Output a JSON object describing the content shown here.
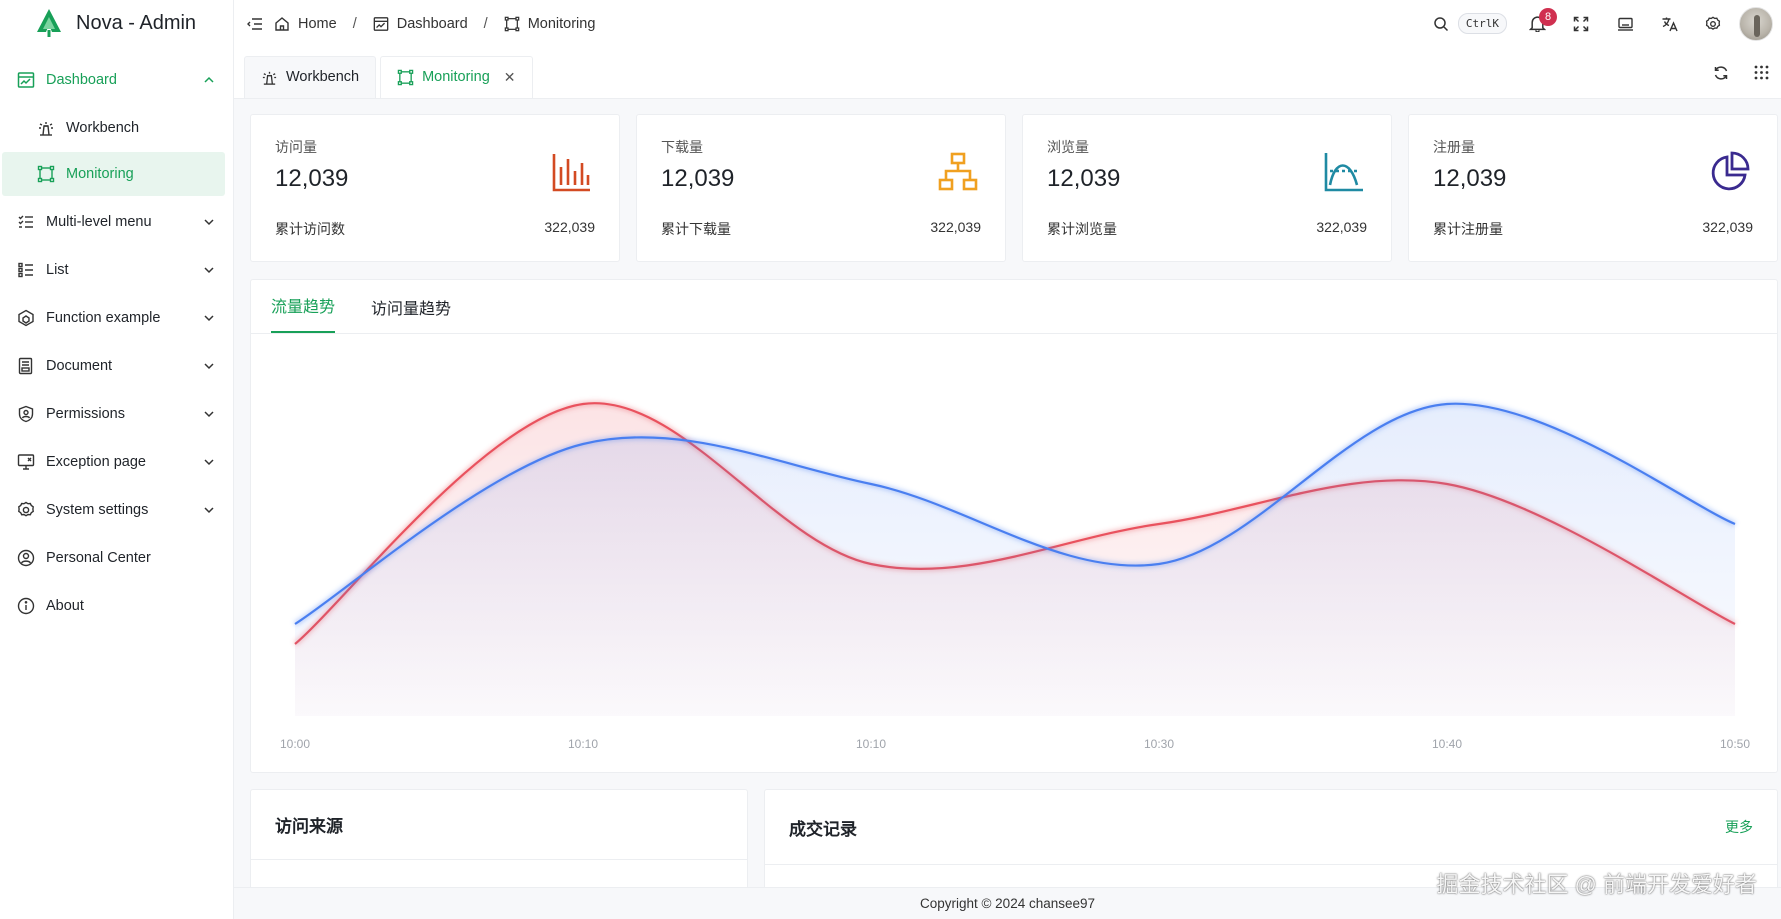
{
  "app": {
    "title": "Nova - Admin",
    "brand_color": "#18a058"
  },
  "sidebar": {
    "items": [
      {
        "label": "Dashboard",
        "icon": "dashboard-icon",
        "open": true,
        "children": [
          {
            "label": "Workbench",
            "icon": "lighthouse-icon"
          },
          {
            "label": "Monitoring",
            "icon": "monitor-frame-icon",
            "active": true
          }
        ]
      },
      {
        "label": "Multi-level menu",
        "icon": "multilevel-list-icon"
      },
      {
        "label": "List",
        "icon": "list-icon"
      },
      {
        "label": "Function example",
        "icon": "cube-icon"
      },
      {
        "label": "Document",
        "icon": "document-icon"
      },
      {
        "label": "Permissions",
        "icon": "shield-user-icon"
      },
      {
        "label": "Exception page",
        "icon": "monitor-error-icon"
      },
      {
        "label": "System settings",
        "icon": "gear-icon"
      },
      {
        "label": "Personal Center",
        "icon": "user-circle-icon"
      },
      {
        "label": "About",
        "icon": "info-icon"
      }
    ]
  },
  "header": {
    "breadcrumb": [
      "Home",
      "Dashboard",
      "Monitoring"
    ],
    "search_shortcut": "CtrlK",
    "notification_count": "8"
  },
  "tabs": [
    {
      "label": "Workbench"
    },
    {
      "label": "Monitoring",
      "active": true,
      "closable": true
    }
  ],
  "stats": [
    {
      "title": "访问量",
      "value": "12,039",
      "foot_label": "累计访问数",
      "foot_value": "322,039",
      "icon": "bar-chart-icon",
      "color": "#d34a22"
    },
    {
      "title": "下载量",
      "value": "12,039",
      "foot_label": "累计下载量",
      "foot_value": "322,039",
      "icon": "hierarchy-icon",
      "color": "#f0a020"
    },
    {
      "title": "浏览量",
      "value": "12,039",
      "foot_label": "累计浏览量",
      "foot_value": "322,039",
      "icon": "curve-chart-icon",
      "color": "#1f8aa3"
    },
    {
      "title": "注册量",
      "value": "12,039",
      "foot_label": "累计注册量",
      "foot_value": "322,039",
      "icon": "pie-chart-icon",
      "color": "#3a2a8f"
    }
  ],
  "chart_tabs": [
    "流量趋势",
    "访问量趋势"
  ],
  "chart_data": {
    "type": "line",
    "x": [
      "10:00",
      "10:10",
      "10:10",
      "10:30",
      "10:40",
      "10:50"
    ],
    "series": [
      {
        "values": [
          10,
          70,
          30,
          40,
          50,
          15
        ],
        "color": "#e9525e",
        "smooth": true,
        "area": true
      },
      {
        "values": [
          15,
          60,
          50,
          30,
          70,
          40
        ],
        "color": "#4a7ff0",
        "smooth": true,
        "area": true
      }
    ],
    "grid": false,
    "ylim": [
      -8,
      85
    ]
  },
  "panels": {
    "sources_title": "访问来源",
    "deals_title": "成交记录",
    "deals_more": "更多"
  },
  "footer": {
    "copyright": "Copyright © 2024 chansee97"
  },
  "watermark": "掘金技术社区 @ 前端开发爱好者"
}
